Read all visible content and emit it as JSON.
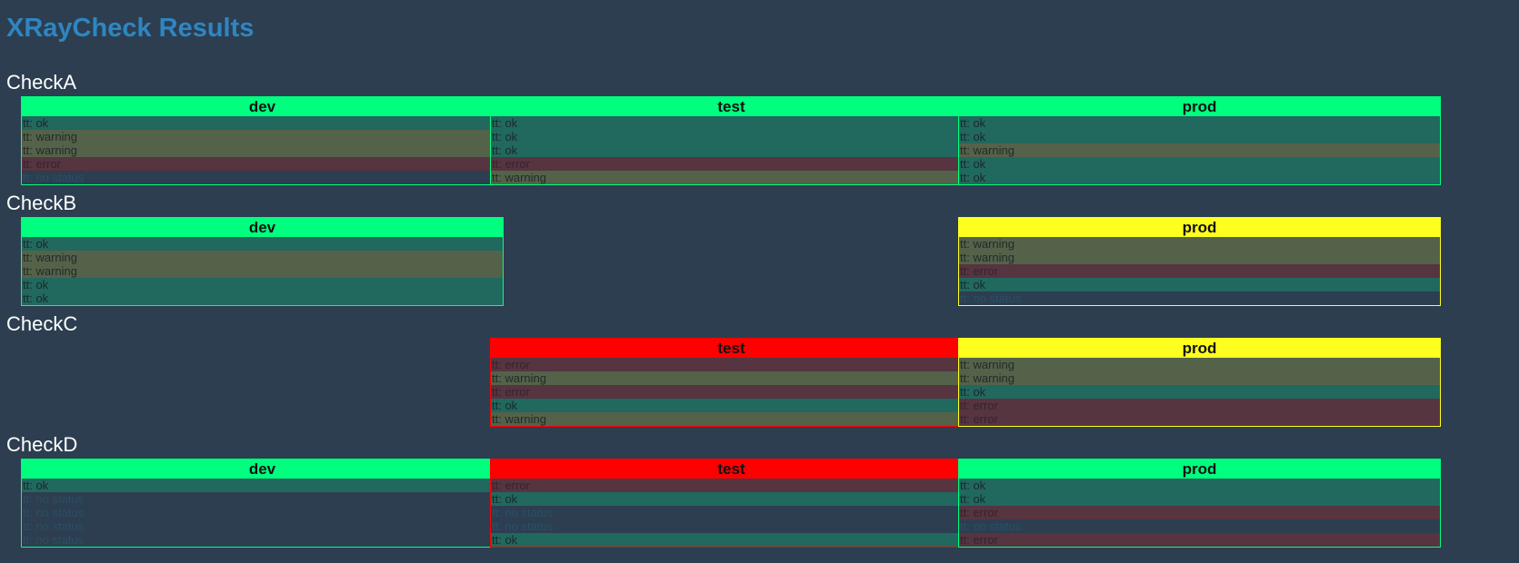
{
  "title": "XRayCheck Results",
  "status_colors": {
    "green": "#00ff7f",
    "yellow": "#ffff1f",
    "red": "#ff0000",
    "ok_row": "#21685e",
    "warning_row": "#546249",
    "error_row": "#563440",
    "nostatus_row": "#2c3e50"
  },
  "checks": [
    {
      "name": "CheckA",
      "envs": [
        {
          "label": "dev",
          "status": "green",
          "rows": [
            {
              "text": "tt: ok",
              "state": "ok"
            },
            {
              "text": "tt: warning",
              "state": "warning"
            },
            {
              "text": "tt: warning",
              "state": "warning"
            },
            {
              "text": "tt: error",
              "state": "error"
            },
            {
              "text": "tt: no status",
              "state": "nostatus"
            }
          ]
        },
        {
          "label": "test",
          "status": "green",
          "rows": [
            {
              "text": "tt: ok",
              "state": "ok"
            },
            {
              "text": "tt: ok",
              "state": "ok"
            },
            {
              "text": "tt: ok",
              "state": "ok"
            },
            {
              "text": "tt: error",
              "state": "error"
            },
            {
              "text": "tt: warning",
              "state": "warning"
            }
          ]
        },
        {
          "label": "prod",
          "status": "green",
          "rows": [
            {
              "text": "tt: ok",
              "state": "ok"
            },
            {
              "text": "tt: ok",
              "state": "ok"
            },
            {
              "text": "tt: warning",
              "state": "warning"
            },
            {
              "text": "tt: ok",
              "state": "ok"
            },
            {
              "text": "tt: ok",
              "state": "ok"
            }
          ]
        }
      ]
    },
    {
      "name": "CheckB",
      "envs": [
        {
          "label": "dev",
          "status": "green",
          "rows": [
            {
              "text": "tt: ok",
              "state": "ok"
            },
            {
              "text": "tt: warning",
              "state": "warning"
            },
            {
              "text": "tt: warning",
              "state": "warning"
            },
            {
              "text": "tt: ok",
              "state": "ok"
            },
            {
              "text": "tt: ok",
              "state": "ok"
            }
          ]
        },
        null,
        {
          "label": "prod",
          "status": "yellow",
          "rows": [
            {
              "text": "tt: warning",
              "state": "warning"
            },
            {
              "text": "tt: warning",
              "state": "warning"
            },
            {
              "text": "tt: error",
              "state": "error"
            },
            {
              "text": "tt: ok",
              "state": "ok"
            },
            {
              "text": "tt: no status",
              "state": "nostatus"
            }
          ]
        }
      ]
    },
    {
      "name": "CheckC",
      "envs": [
        null,
        {
          "label": "test",
          "status": "red",
          "rows": [
            {
              "text": "tt: error",
              "state": "error"
            },
            {
              "text": "tt: warning",
              "state": "warning"
            },
            {
              "text": "tt: error",
              "state": "error"
            },
            {
              "text": "tt: ok",
              "state": "ok"
            },
            {
              "text": "tt: warning",
              "state": "warning"
            }
          ]
        },
        {
          "label": "prod",
          "status": "yellow",
          "rows": [
            {
              "text": "tt: warning",
              "state": "warning"
            },
            {
              "text": "tt: warning",
              "state": "warning"
            },
            {
              "text": "tt: ok",
              "state": "ok"
            },
            {
              "text": "tt: error",
              "state": "error"
            },
            {
              "text": "tt: error",
              "state": "error"
            }
          ]
        }
      ]
    },
    {
      "name": "CheckD",
      "envs": [
        {
          "label": "dev",
          "status": "green",
          "rows": [
            {
              "text": "tt: ok",
              "state": "ok"
            },
            {
              "text": "tt: no status",
              "state": "nostatus"
            },
            {
              "text": "tt: no status",
              "state": "nostatus"
            },
            {
              "text": "tt: no status",
              "state": "nostatus"
            },
            {
              "text": "tt: no status",
              "state": "nostatus"
            }
          ]
        },
        {
          "label": "test",
          "status": "red",
          "rows": [
            {
              "text": "tt: error",
              "state": "error"
            },
            {
              "text": "tt: ok",
              "state": "ok"
            },
            {
              "text": "tt: no status",
              "state": "nostatus"
            },
            {
              "text": "tt: no status",
              "state": "nostatus"
            },
            {
              "text": "tt: ok",
              "state": "ok"
            }
          ]
        },
        {
          "label": "prod",
          "status": "green",
          "rows": [
            {
              "text": "tt: ok",
              "state": "ok"
            },
            {
              "text": "tt: ok",
              "state": "ok"
            },
            {
              "text": "tt: error",
              "state": "error"
            },
            {
              "text": "tt: no status",
              "state": "nostatus"
            },
            {
              "text": "tt: error",
              "state": "error"
            }
          ]
        }
      ]
    }
  ]
}
